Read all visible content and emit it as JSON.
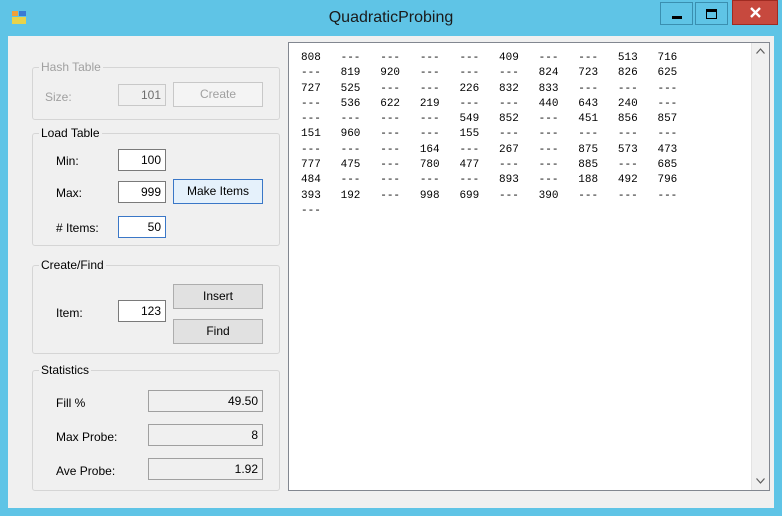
{
  "window": {
    "title": "QuadraticProbing"
  },
  "hash_table": {
    "legend": "Hash Table",
    "size_label": "Size:",
    "size_value": "101",
    "create_label": "Create"
  },
  "load_table": {
    "legend": "Load Table",
    "min_label": "Min:",
    "min_value": "100",
    "max_label": "Max:",
    "max_value": "999",
    "items_label": "# Items:",
    "items_value": "50",
    "make_items_label": "Make Items"
  },
  "create_find": {
    "legend": "Create/Find",
    "item_label": "Item:",
    "item_value": "123",
    "insert_label": "Insert",
    "find_label": "Find"
  },
  "statistics": {
    "legend": "Statistics",
    "fill_label": "Fill %",
    "fill_value": "49.50",
    "max_probe_label": "Max Probe:",
    "max_probe_value": "8",
    "ave_probe_label": "Ave Probe:",
    "ave_probe_value": "1.92"
  },
  "table_rows": [
    [
      "808",
      "---",
      "---",
      "---",
      "---",
      "409",
      "---",
      "---",
      "513",
      "716"
    ],
    [
      "---",
      "819",
      "920",
      "---",
      "---",
      "---",
      "824",
      "723",
      "826",
      "625"
    ],
    [
      "727",
      "525",
      "---",
      "---",
      "226",
      "832",
      "833",
      "---",
      "---",
      "---"
    ],
    [
      "---",
      "536",
      "622",
      "219",
      "---",
      "---",
      "440",
      "643",
      "240",
      "---"
    ],
    [
      "---",
      "---",
      "---",
      "---",
      "549",
      "852",
      "---",
      "451",
      "856",
      "857"
    ],
    [
      "151",
      "960",
      "---",
      "---",
      "155",
      "---",
      "---",
      "---",
      "---",
      "---"
    ],
    [
      "---",
      "---",
      "---",
      "164",
      "---",
      "267",
      "---",
      "875",
      "573",
      "473"
    ],
    [
      "777",
      "475",
      "---",
      "780",
      "477",
      "---",
      "---",
      "885",
      "---",
      "685"
    ],
    [
      "484",
      "---",
      "---",
      "---",
      "---",
      "893",
      "---",
      "188",
      "492",
      "796"
    ],
    [
      "393",
      "192",
      "---",
      "998",
      "699",
      "---",
      "390",
      "---",
      "---",
      "---"
    ],
    [
      "---"
    ]
  ],
  "icons": {
    "app": "app-icon",
    "minimize": "minimize-icon",
    "maximize": "maximize-icon",
    "close": "close-icon",
    "scroll_up": "scroll-up-icon",
    "scroll_down": "scroll-down-icon"
  },
  "colors": {
    "frame": "#5fc4e6",
    "close": "#c7493e",
    "client": "#f0f0f0"
  }
}
